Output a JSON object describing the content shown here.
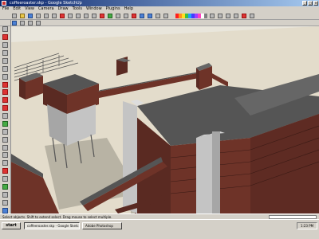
{
  "window": {
    "title": "coffeeroaster.skp - Google SketchUp",
    "controls": [
      "_",
      "□",
      "×"
    ]
  },
  "menu": {
    "items": [
      "File",
      "Edit",
      "View",
      "Camera",
      "Draw",
      "Tools",
      "Window",
      "Plugins",
      "Help"
    ]
  },
  "colors": {
    "sky": "#e9e6dc",
    "ground": "#e3dccb",
    "brick": "#5a2a22",
    "roof": "#555555",
    "concrete": "#a6a6a6",
    "shadow": "#b8b3a4"
  },
  "icons": {
    "toolbar": [
      "new-icon",
      "open-icon",
      "save-icon",
      "cut-icon",
      "copy-icon",
      "paste-icon",
      "erase-icon",
      "undo-icon",
      "redo-icon",
      "print-icon",
      "select-icon",
      "paint-icon",
      "orbit-icon",
      "pan-icon",
      "zoom-icon",
      "zoom-extents-icon",
      "prev-view-icon",
      "next-view-icon",
      "iso-icon",
      "top-icon",
      "front-icon",
      "right-icon",
      "back-icon",
      "left-icon",
      "xray-icon",
      "wireframe-icon",
      "hidden-line-icon",
      "shaded-icon",
      "textured-icon",
      "monochrome-icon"
    ],
    "side": [
      "select-icon",
      "eraser-icon",
      "line-icon",
      "arc-icon",
      "rectangle-icon",
      "circle-icon",
      "polygon-icon",
      "freehand-icon",
      "move-icon",
      "push-pull-icon",
      "rotate-icon",
      "follow-me-icon",
      "scale-icon",
      "offset-icon",
      "tape-icon",
      "dimension-icon",
      "protractor-icon",
      "text-icon",
      "axes-icon",
      "3d-text-icon",
      "orbit-icon",
      "pan-icon",
      "zoom-icon",
      "walk-icon"
    ]
  },
  "statusbar": {
    "text": "Select objects. Shift to extend select. Drag mouse to select multiple."
  },
  "taskbar": {
    "start_label": "start",
    "tasks": [
      {
        "label": "coffeeroaster.skp - Google SketchUp"
      },
      {
        "label": "Adobe Photoshop"
      }
    ],
    "clock": "1:23 PM"
  }
}
